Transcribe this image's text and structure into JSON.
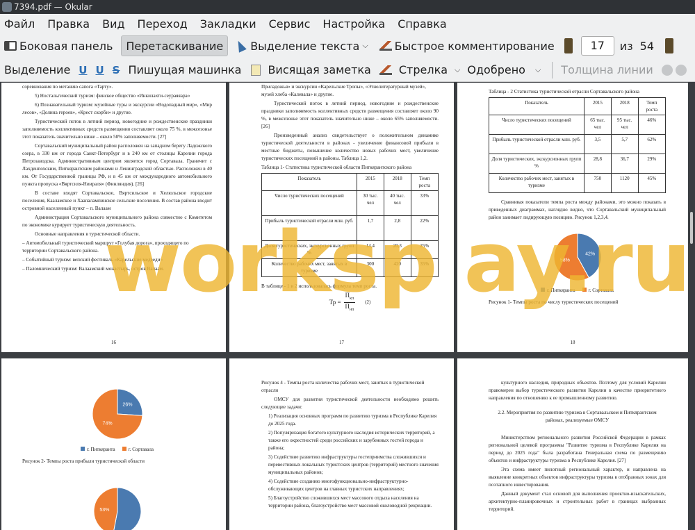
{
  "window": {
    "title": "7394.pdf  — Okular"
  },
  "menu": [
    "Файл",
    "Правка",
    "Вид",
    "Переход",
    "Закладки",
    "Сервис",
    "Настройка",
    "Справка"
  ],
  "toolbar1": {
    "sidebar": "Боковая панель",
    "browse": "Перетаскивание",
    "text_select": "Выделение текста",
    "quick_annotate": "Быстрое комментирование",
    "page_current": "17",
    "page_of": "из",
    "page_total": "54"
  },
  "toolbar2": {
    "highlight": "Выделение",
    "typewriter": "Пишущая машинка",
    "popup_note": "Висящая заметка",
    "arrow": "Стрелка",
    "approved": "Одобрено",
    "line_width": "Толщина линии"
  },
  "watermark": "worksp ay.ru",
  "pages": {
    "p16": {
      "lines": [
        "ралли «Белые ночи», сплав - рафтинг «Три стихии», скалолазание, международные соревнования по метанию сапога «Тарту».",
        "5) Ностальгический туризм: финское общество «Инкилахти-сеураяяара»",
        "6) Познавательный туризм: музейные туры и экскурсии «Водопадный мир», «Мир лесов», «Долина героев», «Крест скорби» и другие.",
        "Туристический поток в летний период, новогодние и рождественские праздники заполняемость коллективных средств размещения составляет около 75 %, в межсезонье этот показатель значительно ниже – около 50% заполняемости. [27]",
        "Сортавальский муниципальный район расположен на западном берегу Ладожского озера, в 330 км от города Санкт-Петербург и в 240 км от столицы Карелии города Петрозаводска. Административным центром является город Сортавала. Граничит с Лахденпохским, Питкярантским районами и Ленинградской областью. Расположен в 40 км. От Государственной границы РФ, и в 45 км от международного автомобильного пункта пропуска «Вяртсиля-Ниираля» (Финляндия). [26]",
        "В составе входят Сортавальское, Вяртсильское и Хелюльское городские поселения, Кааламское и Хаапалампинское сельские поселения. В состав района входит островной населенный пункт – п. Валаам",
        "Администрация Сортавальского муниципального района совместно с Комитетом по экономике курирует туристическую деятельность.",
        "Основные направления в туристической области.",
        "–  Автомобильный туристический маршрут «Голубая дорога», проходящего по территории Сортавальского района.",
        "–  Событийный туризм: вепский фестиваль «Карельские медведи»",
        "–  Паломнический туризм: Валаамский монастырь, остров Валаам."
      ],
      "num": "16"
    },
    "p17": {
      "lines": [
        "–  Познавательный туризм: музейные туры «Региональный музей Северного Приладожья» и экскурсии «Карельские Тропы», «Этнолитературный музей», музей хлеба «Калевала» и другие.",
        "Туристический поток в летний период, новогодние и рождественские праздники заполняемость коллективных средств размещения составляет около 90 %, в межсезонье этот показатель значительно ниже – около 65% заполняемости. [26]",
        "Произведенный анализ свидетельствует о положительном динамике туристической деятельности в районах - увеличение финансовой прибыли в местные бюджеты, повышение количество новых рабочих мест, увеличение туристических посещений в районы. Таблица 1,2."
      ],
      "table_caption": "Таблица 1- Статистика туристической области Питкярантского района",
      "table_head": [
        "Показатель",
        "2015",
        "2018",
        "Темп роста"
      ],
      "table_rows": [
        [
          "Число туристических посещений",
          "30 тыс. чел",
          "40 тыс. чел",
          "33%"
        ],
        [
          "Прибыль туристической отрасли млн. руб.",
          "1,7",
          "2,8",
          "22%"
        ],
        [
          "Доля туристических, экскурсионных групп %",
          "14,4",
          "20,3",
          "25%"
        ],
        [
          "Количество рабочих мест, занятых в туризме",
          "300",
          "420",
          "35%"
        ]
      ],
      "formula_intro": "В таблице - 1 и 2 использовалась формула темп роста.",
      "formula_lhs": "Тр =",
      "formula_num": "П",
      "formula_num_sub": "кп",
      "formula_den": "П",
      "formula_den_sub": "нп",
      "formula_ref": "(2)",
      "num": "17"
    },
    "p18": {
      "table_caption": "Таблица - 2 Статистика туристической отрасли Сортавальского района",
      "table_head": [
        "Показатель",
        "2015",
        "2018",
        "Темп роста"
      ],
      "table_rows": [
        [
          "Число туристических посещений",
          "65 тыс. чел",
          "95 тыс. чел",
          "46%"
        ],
        [
          "Прибыль туристической отрасли млн. руб.",
          "3,5",
          "5,7",
          "62%"
        ],
        [
          "Доля туристических, экскурсионных групп %",
          "28,8",
          "36,7",
          "29%"
        ],
        [
          "Количество рабочих мест, занятых в туризме",
          "750",
          "1120",
          "45%"
        ]
      ],
      "text": "Сравнивая показатели темпа роста между районами, это можно показать в приведенных диаграммах, наглядно видно, что Сортавальский муниципальный район занимает лидирующую позицию. Рисунок 1,2,3,4.",
      "figure_caption": "Рисунок 1- Темпы роста по числу туристических посещений",
      "num": "18"
    },
    "p19": {
      "figure_caption": "Рисунок 2- Темпы роста прибыли туристической области"
    },
    "p20": {
      "lines_title": "Рисунок 4 - Темпы роста количества рабочих мест, занятых в туристической отрасли",
      "intro": "ОМСУ для развития туристической деятельности необходимо решить следующие задачи:",
      "items": [
        "1)  Реализация основных программ по развитию туризма в Республике Карелия до 2025 года.",
        "2)  Популяризация богатого культурного наследия исторических территорий, а также его окрестностей среди российских и зарубежных гостей города и района;",
        "3)  Содействие развитию инфраструктуры гостеприимства сложившихся и перевестивных локальных туристских центров (территорий) местного значения муниципальных районов;",
        "4)  Содействие созданию многофункционально-инфраструктурно-обслуживающих центров на главных туристских направлениях;",
        "5)  Благоустройство сложившихся мест массового отдыха населения на территории района, благоустройство мест массовой околоводной рекреации."
      ]
    },
    "p21": {
      "p1": "культурного наследия, природных объектов. Поэтому для условий Карелии правомерен выбор туристического развития Карелии в качестве приоритетного направления по отношению к ее промышленному развитию.",
      "heading": "2.2. Мероприятия по развитию туризма в Сортавальском и Питкярантском районах, реализуемые ОМСУ",
      "p2": "Министерством регионального развития Российской Федерации в рамках региональной целевой программы \"Развитие туризма в Республике Карелия на период до 2025 года\" была разработана Генеральная схема по размещению объектов и инфраструктуры туризма в Республике Карелия. [27]",
      "p3": "Эта схема имеет пилотный региональный характер, и направлена на выявление конкретных объектов инфраструктуры туризма в отобранных зонах для поэтапного инвестирования.",
      "p4": "Данный документ стал основой для выполнения проектно-изыскательских, архитектурно-планировочных и строительных работ в границах выбранных территорий."
    }
  },
  "chart_data": [
    {
      "type": "pie",
      "title": "",
      "categories": [
        "г. Питкяранта",
        "г. Сортавала"
      ],
      "values": [
        42,
        58
      ],
      "labels": [
        "42%",
        "58%"
      ],
      "colors": [
        "#4a7ab0",
        "#ed7d31"
      ]
    },
    {
      "type": "pie",
      "title": "",
      "categories": [
        "г. Питкяранта",
        "г. Сортавала"
      ],
      "values": [
        26,
        74
      ],
      "labels": [
        "26%",
        "74%"
      ],
      "colors": [
        "#4a7ab0",
        "#ed7d31"
      ]
    },
    {
      "type": "pie",
      "title": "",
      "categories": [],
      "values": [
        53,
        47
      ],
      "labels": [
        "",
        "53%"
      ],
      "colors": [
        "#4a7ab0",
        "#ed7d31"
      ]
    }
  ]
}
